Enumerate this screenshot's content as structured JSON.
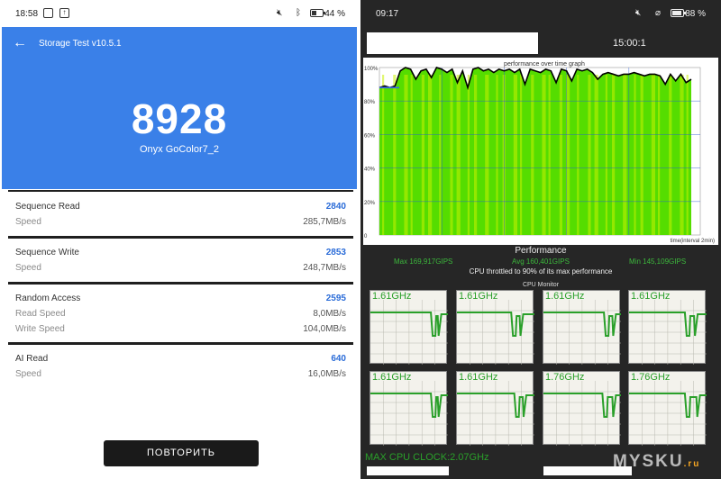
{
  "left": {
    "status": {
      "time": "18:58",
      "battery": "44 %",
      "battery_level": 0.44
    },
    "header": {
      "title": "Storage Test v10.5.1",
      "score": "8928",
      "device": "Onyx GoColor7_2"
    },
    "results": [
      {
        "name": "Sequence Read",
        "score": "2840",
        "details": [
          {
            "label": "Speed",
            "value": "285,7MB/s"
          }
        ]
      },
      {
        "name": "Sequence Write",
        "score": "2853",
        "details": [
          {
            "label": "Speed",
            "value": "248,7MB/s"
          }
        ]
      },
      {
        "name": "Random Access",
        "score": "2595",
        "details": [
          {
            "label": "Read Speed",
            "value": "8,0MB/s"
          },
          {
            "label": "Write Speed",
            "value": "104,0MB/s"
          }
        ]
      },
      {
        "name": "AI Read",
        "score": "640",
        "details": [
          {
            "label": "Speed",
            "value": "16,0MB/s"
          }
        ]
      }
    ],
    "retry_label": "ПОВТОРИТЬ"
  },
  "right": {
    "status": {
      "time": "09:17",
      "battery": "88 %",
      "battery_level": 0.88
    },
    "duration": "15:00:1",
    "chart_data": {
      "type": "line",
      "title": "performance over time graph",
      "xlabel": "time(interval 2min)",
      "ylabel": "",
      "ylim": [
        0,
        100
      ],
      "yticks": [
        "0",
        "20%",
        "40%",
        "60%",
        "80%",
        "100%"
      ],
      "x": [
        0,
        0.25,
        0.5,
        0.75,
        1,
        1.25,
        1.5,
        1.75,
        2,
        2.25,
        2.5,
        2.75,
        3,
        3.25,
        3.5,
        3.75,
        4,
        4.25,
        4.5,
        4.75,
        5,
        5.25,
        5.5,
        5.75,
        6,
        6.25,
        6.5,
        6.75,
        7,
        7.25,
        7.5,
        7.75,
        8,
        8.25,
        8.5,
        8.75,
        9,
        9.25,
        9.5,
        9.75,
        10,
        10.25,
        10.5,
        10.75,
        11,
        11.25,
        11.5,
        11.75,
        12,
        12.25,
        12.5,
        12.75,
        13,
        13.25,
        13.5,
        13.75,
        14,
        14.25,
        14.5,
        14.75,
        15
      ],
      "series": [
        {
          "values": [
            88,
            89,
            88,
            89,
            98,
            100,
            99,
            93,
            98,
            99,
            94,
            100,
            99,
            97,
            99,
            91,
            98,
            88,
            99,
            100,
            98,
            99,
            97,
            99,
            98,
            99,
            97,
            99,
            90,
            99,
            98,
            97,
            99,
            98,
            91,
            99,
            98,
            92,
            99,
            98,
            99,
            97,
            93,
            96,
            97,
            96,
            95,
            96,
            96,
            97,
            96,
            95,
            96,
            96,
            95,
            90,
            96,
            92,
            96,
            91,
            93
          ]
        }
      ],
      "grid": true,
      "colors": {
        "fill": "#55dd00",
        "stripe": "#c8f000",
        "line": "#000000",
        "grid": "#2a5bd7"
      }
    },
    "performance": {
      "heading": "Performance",
      "max": "Max 169,917GIPS",
      "avg": "Avg 160,401GIPS",
      "min": "Min 145,109GIPS",
      "note": "CPU throttled to 90% of its max performance"
    },
    "cpu_monitor": {
      "title": "CPU Monitor",
      "cores": [
        {
          "freq": "1.61GHz",
          "drops": [
            0.78,
            0.88
          ]
        },
        {
          "freq": "1.61GHz",
          "drops": [
            0.7,
            0.82
          ]
        },
        {
          "freq": "1.61GHz",
          "drops": [
            0.78,
            0.9
          ]
        },
        {
          "freq": "1.61GHz",
          "drops": [
            0.72,
            0.85
          ]
        },
        {
          "freq": "1.61GHz",
          "drops": [
            0.78,
            0.88
          ]
        },
        {
          "freq": "1.61GHz",
          "drops": [
            0.74,
            0.86
          ]
        },
        {
          "freq": "1.76GHz",
          "drops": [
            0.76,
            0.9
          ]
        },
        {
          "freq": "1.76GHz",
          "drops": [
            0.72,
            0.88
          ]
        }
      ],
      "max_clock": "MAX CPU CLOCK:2.07GHz"
    },
    "watermark": {
      "main": "MYSKU",
      "suffix": ".ru"
    }
  }
}
